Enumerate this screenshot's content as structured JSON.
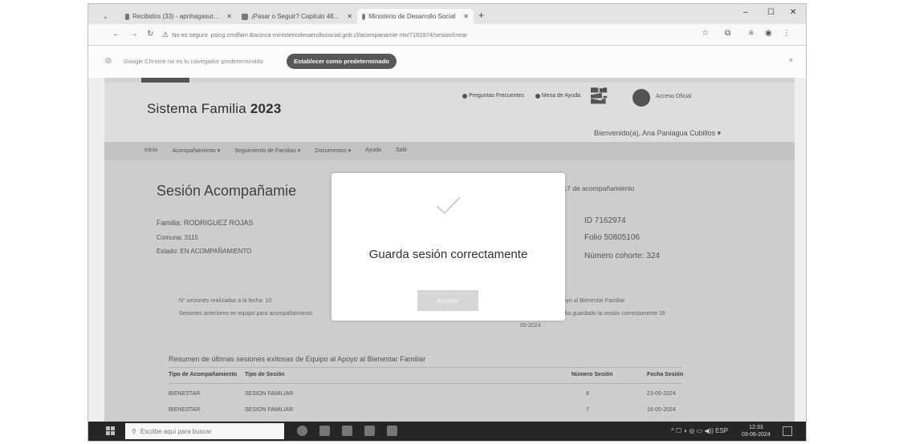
{
  "browser": {
    "tabs": [
      {
        "label": "Recibidos (33) - apnhagasur..."
      },
      {
        "label": "¡Pasar o Seguir? Capitulo 48..."
      },
      {
        "label": "Ministerio de Desarrollo Social"
      }
    ],
    "new_tab": "+",
    "window_controls": {
      "minimize": "–",
      "maximize": "☐",
      "close": "✕"
    },
    "address": {
      "security_label": "No es seguro",
      "url": "psicg.cmdfam.Bacinca ministeriodesarrollosocial.gob.cl/acompanamie nto/7162974/sesion/crear"
    },
    "infobar": {
      "message": "Google Chrome no es tu navegador predeterminado",
      "button": "Establecer como predeterminado",
      "close": "×"
    }
  },
  "page": {
    "title_prefix": "Sistema Familia",
    "title_year": "2023",
    "header_links": [
      "Preguntas Frecuentes",
      "Mesa de Ayuda"
    ],
    "user_office": "Acceso Oficial",
    "welcome": "Bienvenido(a), Ana Paniagua Cubillos ▾",
    "menu": [
      "Inicio",
      "Acompañamiento ▾",
      "Seguimiento de Familias ▾",
      "Documentos ▾",
      "Ayuda",
      "Salir"
    ],
    "session_title": "Sesión Acompañamie",
    "session_subtitle": "mes 17 de acompañamiento",
    "family": {
      "name": "Familia: RODRIGUEZ ROJAS",
      "comuna": "Comuna: 3115",
      "estado": "Estado: EN ACOMPAÑAMIENTO"
    },
    "right_info": {
      "id": "ID 7162974",
      "folio": "Folio 50805106",
      "cohorte": "Número cohorte: 324"
    },
    "notes": {
      "left1": "N° sesiones realizadas a la fecha: 10",
      "left2": "Sesiones anteriores en equipo para acompañamiento",
      "right1": "Apoyo al Bienestar Familiar",
      "right2": "Se ha guardado la sesión correctamente 26",
      "right3": "05-2024"
    },
    "resumen": "Resumen de últimas sesiones exitosas de Equipo al Apoyo al Bienestar Familiar",
    "table": {
      "headers": [
        "Tipo de Acompañamiento",
        "Tipo de Sesión",
        "Número Sesión",
        "Fecha Sesión"
      ],
      "rows": [
        [
          "BIENESTAR",
          "SESION FAMILIAR",
          "8",
          "23-05-2024"
        ],
        [
          "BIENESTAR",
          "SESION FAMILIAR",
          "7",
          "16-05-2024"
        ]
      ]
    }
  },
  "modal": {
    "message": "Guarda sesión correctamente",
    "button": "Aceptar"
  },
  "taskbar": {
    "search_placeholder": "Escribe aquí para buscar",
    "tray": "^ ☐ ◖ ◎ ▭ ◀)) ESP",
    "time": "12:33",
    "date": "03-06-2024"
  }
}
